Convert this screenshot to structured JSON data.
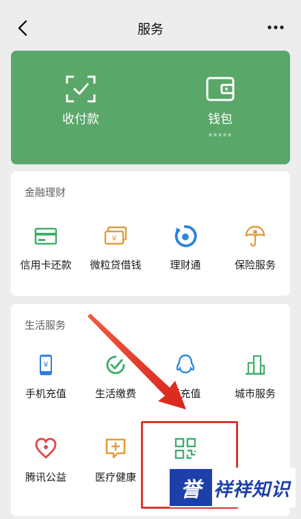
{
  "header": {
    "title": "服务",
    "back_icon": "chevron-left-icon",
    "more_icon": "more-horizontal-icon"
  },
  "wallet": {
    "items": [
      {
        "label": "收付款",
        "icon": "scan-check-icon"
      },
      {
        "label": "钱包",
        "sub": "*****",
        "icon": "wallet-icon"
      }
    ],
    "background": "#5aa76a"
  },
  "finance": {
    "title": "金融理财",
    "items": [
      {
        "label": "信用卡还款",
        "icon": "credit-card-icon",
        "color": "#3fae6a"
      },
      {
        "label": "微粒贷借钱",
        "icon": "loan-icon",
        "color": "#e39a3b"
      },
      {
        "label": "理财通",
        "icon": "wealth-icon",
        "color": "#2f86d6"
      },
      {
        "label": "保险服务",
        "icon": "insurance-icon",
        "color": "#e39a3b"
      }
    ]
  },
  "life": {
    "title": "生活服务",
    "items": [
      {
        "label": "手机充值",
        "icon": "phone-recharge-icon",
        "color": "#2f7fe0"
      },
      {
        "label": "生活缴费",
        "icon": "bill-pay-icon",
        "color": "#3fae6a"
      },
      {
        "label": "币充值",
        "icon": "qq-coin-icon",
        "color": "#2f86d6"
      },
      {
        "label": "城市服务",
        "icon": "city-service-icon",
        "color": "#3fae6a"
      },
      {
        "label": "腾讯公益",
        "icon": "charity-icon",
        "color": "#e04a4a"
      },
      {
        "label": "医疗健康",
        "icon": "medical-icon",
        "color": "#e39a3b"
      },
      {
        "label": "",
        "icon": "qr-code-icon",
        "color": "#3fae6a"
      }
    ]
  },
  "annotation": {
    "arrow_color": "#e53a2f",
    "box_color": "#d9342b"
  },
  "watermark": {
    "logo_text": "誉",
    "text": "祥祥知识"
  }
}
